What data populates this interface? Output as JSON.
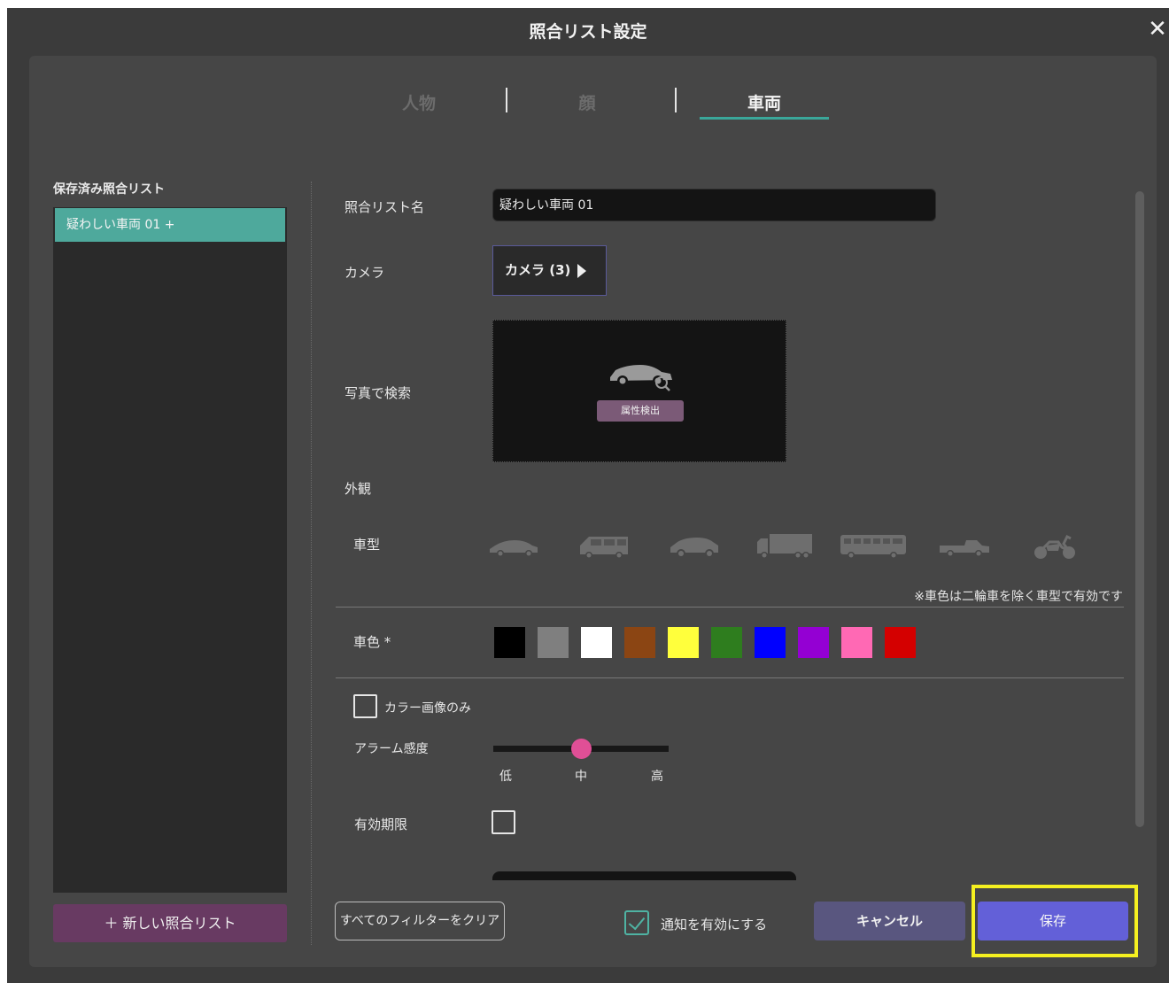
{
  "window": {
    "title": "照合リスト設定",
    "close_icon": "✕"
  },
  "tabs": [
    {
      "label": "人物",
      "active": false
    },
    {
      "label": "顔",
      "active": false
    },
    {
      "label": "車両",
      "active": true
    }
  ],
  "sidebar": {
    "title": "保存済み照合リスト",
    "items": [
      {
        "label": "疑わしい車両 01 +",
        "selected": true
      }
    ],
    "new_button": "＋ 新しい照合リスト"
  },
  "form": {
    "name_label": "照合リスト名",
    "name_value": "疑わしい車両 01",
    "camera_label": "カメラ",
    "camera_button": "カメラ (3)",
    "photo_label": "写真で検索",
    "attr_button": "属性検出",
    "appearance_label": "外観",
    "vehicle_type_label": "車型",
    "vehicle_types": [
      "sedan",
      "van",
      "suv",
      "truck",
      "bus",
      "pickup",
      "motorcycle"
    ],
    "note": "※車色は二輪車を除く車型で有効です",
    "color_label": "車色 *",
    "colors": [
      "#000000",
      "#7f7f7f",
      "#ffffff",
      "#8b4513",
      "#ffff3c",
      "#2e7d1e",
      "#0000ff",
      "#9400d3",
      "#ff69b4",
      "#d40000"
    ],
    "color_only_label": "カラー画像のみ",
    "color_only_checked": false,
    "alarm_label": "アラーム感度",
    "alarm_levels": [
      "低",
      "中",
      "高"
    ],
    "alarm_value": "中",
    "expiry_label": "有効期限",
    "expiry_checked": false
  },
  "footer": {
    "clear_button": "すべてのフィルターをクリア",
    "notify_label": "通知を有効にする",
    "notify_checked": true,
    "cancel_button": "キャンセル",
    "save_button": "保存"
  },
  "accent": {
    "tab_underline": "#3aa79a",
    "save": "#6360d8",
    "cancel": "#59567f",
    "new_list": "#683a62",
    "highlight": "#f5f020"
  }
}
